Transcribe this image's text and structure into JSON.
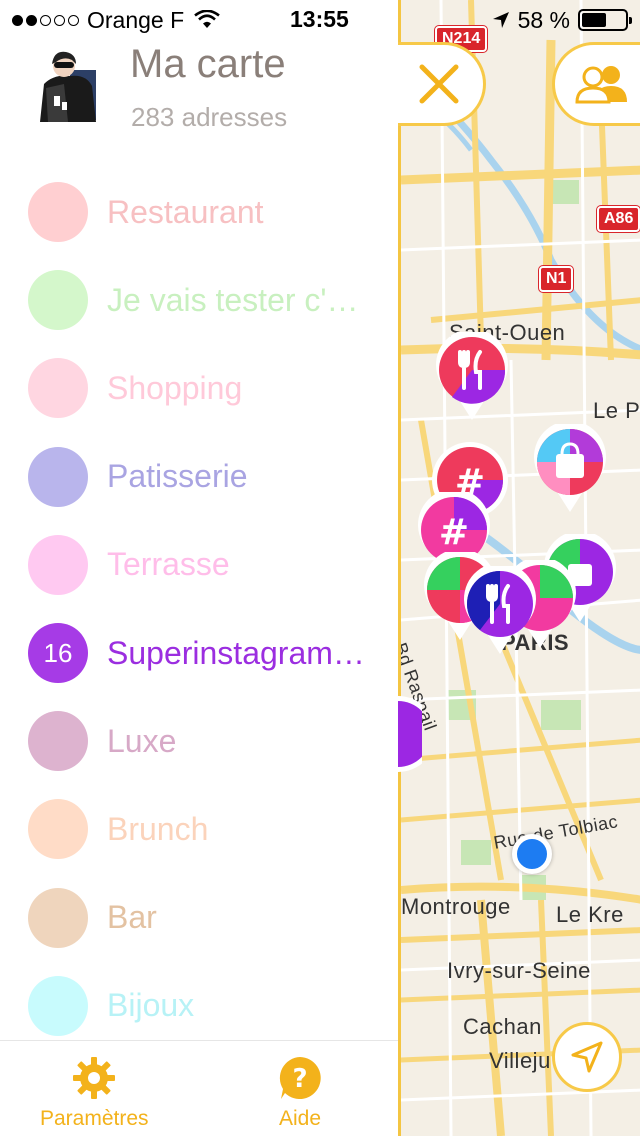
{
  "status_bar": {
    "carrier": "Orange F",
    "time": "13:55",
    "battery_percent": "58 %",
    "battery_level": 0.58
  },
  "profile": {
    "title": "Ma carte",
    "count": "283 adresses"
  },
  "categories": [
    {
      "label": "Restaurant",
      "color": "#ffcfd1",
      "text_color": "#f7c0c2",
      "badge": ""
    },
    {
      "label": "Je vais tester c'…",
      "color": "#d4f7cb",
      "text_color": "#c8f0bf",
      "badge": ""
    },
    {
      "label": "Shopping",
      "color": "#ffd6e1",
      "text_color": "#ffc9d9",
      "badge": ""
    },
    {
      "label": "Patisserie",
      "color": "#b9b5ec",
      "text_color": "#a9a4e2",
      "badge": ""
    },
    {
      "label": "Terrasse",
      "color": "#ffc9f1",
      "text_color": "#ffbde9",
      "badge": ""
    },
    {
      "label": "Superinstagram…",
      "color": "#a63be6",
      "text_color": "#9b2ee0",
      "badge": "16"
    },
    {
      "label": "Luxe",
      "color": "#ddb3cf",
      "text_color": "#d7a9c7",
      "badge": ""
    },
    {
      "label": "Brunch",
      "color": "#ffdcc7",
      "text_color": "#fbd3bb",
      "badge": ""
    },
    {
      "label": "Bar",
      "color": "#efd5bd",
      "text_color": "#e3c2a2",
      "badge": ""
    },
    {
      "label": "Bijoux",
      "color": "#c8fbfd",
      "text_color": "#b7f2f6",
      "badge": ""
    }
  ],
  "tabbar": {
    "settings": "Paramètres",
    "help": "Aide"
  },
  "map": {
    "labels": {
      "saint_ouen": "Saint-Ouen",
      "le_p": "Le P",
      "paris": "PARIS",
      "raspail": "Bd Raspail",
      "tolbiac": "Rue de Tolbiac",
      "montrouge": "Montrouge",
      "le_kre": "Le Kre",
      "ivry": "Ivry-sur-Seine",
      "cachan": "Cachan",
      "villej": "Villeju"
    },
    "badges": {
      "n214": "N214",
      "a86": "A86",
      "n1": "N1"
    }
  },
  "colors": {
    "accent": "#f3b21b",
    "map_bg": "#f4efe5",
    "road": "#f8d77b",
    "water": "#a9d3ee",
    "user_location": "#1d7cf2"
  }
}
